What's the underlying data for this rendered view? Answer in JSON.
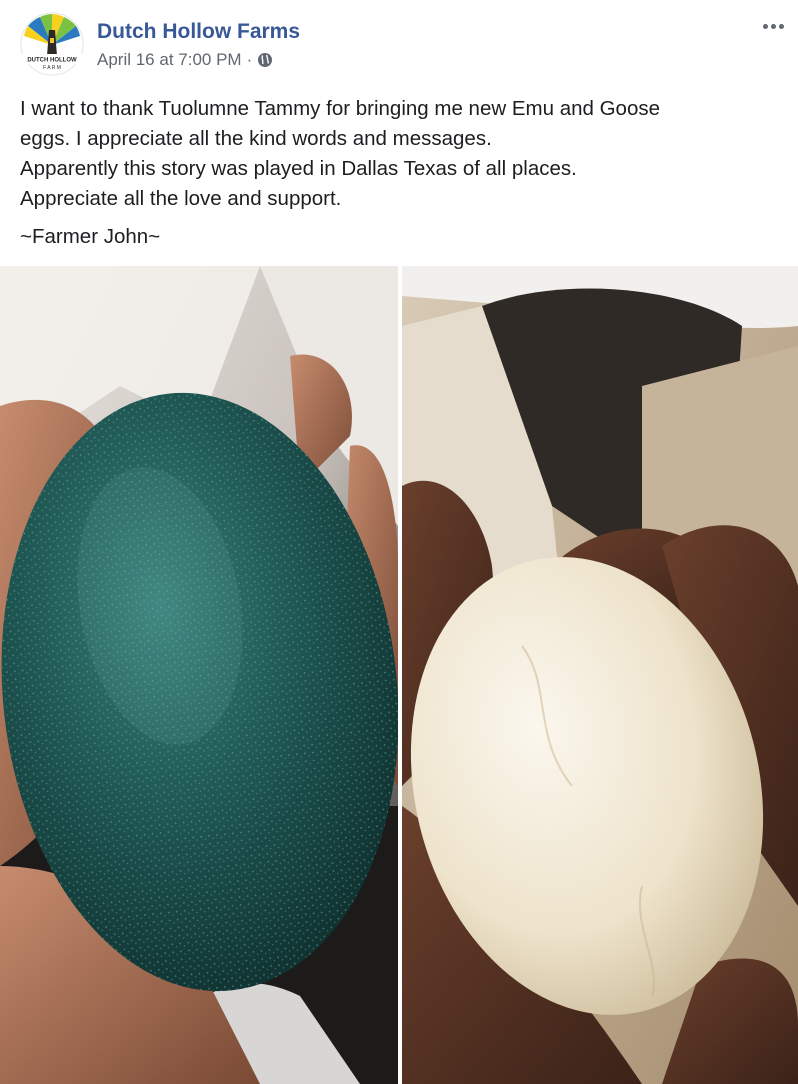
{
  "post": {
    "page_name": "Dutch Hollow Farms",
    "timestamp": "April 16 at 7:00 PM",
    "separator": "·",
    "privacy_icon": "globe-icon",
    "more_icon": "ellipsis-icon",
    "avatar": {
      "logo_text": "DUTCH HOLLOW",
      "logo_subtext": "F A R M"
    },
    "body_lines": [
      "I want to thank Tuolumne Tammy for bringing me new Emu and Goose",
      "eggs. I appreciate all the kind words and messages.",
      "Apparently this story was played in Dallas Texas of all places.",
      "Appreciate all the love and support."
    ],
    "signoff": "~Farmer John~"
  },
  "photos": [
    {
      "subject": "green emu egg held in hand",
      "egg_color": "#1f5a55"
    },
    {
      "subject": "white goose egg held in hand",
      "egg_color": "#efe6d2"
    }
  ],
  "colors": {
    "link": "#385898",
    "meta": "#616770",
    "text": "#1c1e21"
  }
}
